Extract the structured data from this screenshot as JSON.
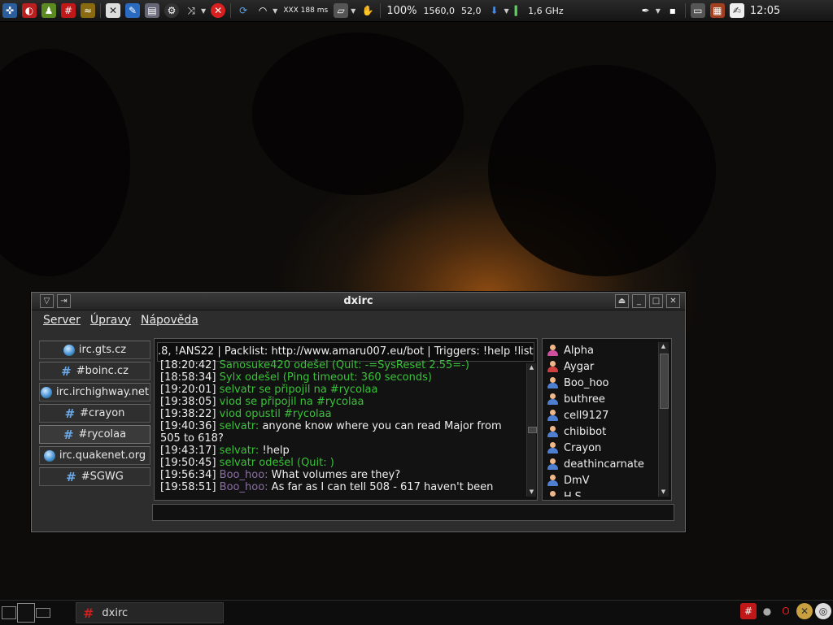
{
  "top_panel": {
    "ping": "XXX 188 ms",
    "battery_percent": "100%",
    "value_a": "1560,0",
    "value_b": "52,0",
    "cpu_freq": "1,6 GHz",
    "clock": "12:05"
  },
  "window": {
    "title": "dxirc"
  },
  "menu": {
    "server": "Server",
    "edit": "Úpravy",
    "help": "Nápověda"
  },
  "tree": [
    {
      "label": "irc.gts.cz",
      "type": "server"
    },
    {
      "label": "#boinc.cz",
      "type": "channel"
    },
    {
      "label": "irc.irchighway.net",
      "type": "server"
    },
    {
      "label": "#crayon",
      "type": "channel"
    },
    {
      "label": "#rycolaa",
      "type": "channel",
      "selected": true
    },
    {
      "label": "irc.quakenet.org",
      "type": "server"
    },
    {
      "label": "#SGWG",
      "type": "channel"
    }
  ],
  "topic": ".8, !ANS22 | Packlist: http://www.amaru007.eu/bot | Triggers: !help !list |",
  "log": [
    {
      "time": "[18:20:42]",
      "nick": "",
      "text": "Sanosuke420 odešel (Quit: -=SysReset 2.55=-)",
      "kind": "event"
    },
    {
      "time": "[18:58:34]",
      "nick": "",
      "text": "Sylx odešel (Ping timeout: 360 seconds)",
      "kind": "event"
    },
    {
      "time": "[19:20:01]",
      "nick": "",
      "text": "selvatr se připojil na #rycolaa",
      "kind": "event"
    },
    {
      "time": "[19:38:05]",
      "nick": "",
      "text": "viod se připojil na #rycolaa",
      "kind": "event"
    },
    {
      "time": "[19:38:22]",
      "nick": "",
      "text": "viod opustil #rycolaa",
      "kind": "event"
    },
    {
      "time": "[19:40:36]",
      "nick": "selvatr:",
      "text": "anyone know where you can read Major from 505 to 618?",
      "kind": "msg-green"
    },
    {
      "time": "[19:43:17]",
      "nick": "selvatr:",
      "text": "!help",
      "kind": "msg-green"
    },
    {
      "time": "[19:50:45]",
      "nick": "",
      "text": "selvatr odešel (Quit: )",
      "kind": "event"
    },
    {
      "time": "[19:56:34]",
      "nick": "Boo_hoo:",
      "text": "What volumes are they?",
      "kind": "msg"
    },
    {
      "time": "[19:58:51]",
      "nick": "Boo_hoo:",
      "text": "As far as I can tell 508 - 617 haven't been",
      "kind": "msg"
    }
  ],
  "users": [
    {
      "name": "Alpha",
      "color": "#d04fa0"
    },
    {
      "name": "Aygar",
      "color": "#d04040"
    },
    {
      "name": "Boo_hoo",
      "color": "#4f7fd0"
    },
    {
      "name": "buthree",
      "color": "#4f7fd0"
    },
    {
      "name": "cell9127",
      "color": "#4f7fd0"
    },
    {
      "name": "chibibot",
      "color": "#4f7fd0"
    },
    {
      "name": "Crayon",
      "color": "#4f7fd0"
    },
    {
      "name": "deathincarnate",
      "color": "#4f7fd0"
    },
    {
      "name": "DmV",
      "color": "#4f7fd0"
    },
    {
      "name": "H.S.",
      "color": "#d0a020"
    }
  ],
  "input": {
    "value": ""
  },
  "taskbar": {
    "task_label": "dxirc"
  },
  "colors": {
    "event_green": "#39c239",
    "nick_purple": "#8b6fa3"
  }
}
